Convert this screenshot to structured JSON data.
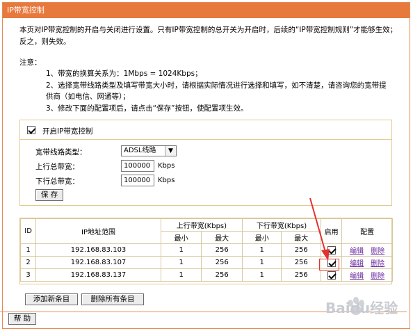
{
  "title": "IP带宽控制",
  "intro": "本页对IP带宽控制的开启与关闭进行设置。只有IP带宽控制的总开关为开启时，后续的“IP带宽控制规则”才能够生效；反之，则失效。",
  "notes": {
    "title": "注意：",
    "line1": "1、带宽的换算关系为：1Mbps = 1024Kbps；",
    "line2a": "2、选择宽带线路类型及填写带宽大小时，请根据实际情况进行选择和填写，如不清楚，请咨询您的宽带提",
    "line2b": "供商（如电信、网通等）；",
    "line3": "3、修改下面的配置项后，请点击“保存”按钮，使配置项生效。"
  },
  "control": {
    "enable_label": "开启IP带宽控制",
    "enabled": true,
    "line_type_label": "宽带线路类型：",
    "line_type_value": "ADSL线路",
    "up_label": "上行总带宽：",
    "up_value": "100000",
    "down_label": "下行总带宽：",
    "down_value": "100000",
    "unit": "Kbps",
    "save_label": "保 存"
  },
  "table": {
    "headers": {
      "id": "ID",
      "ip_range": "IP地址范围",
      "up": "上行带宽(Kbps)",
      "down": "下行带宽(Kbps)",
      "enable": "启用",
      "config": "配置",
      "min": "最小",
      "max": "最大"
    },
    "rows": [
      {
        "id": "1",
        "ip": "192.168.83.103",
        "up_min": "1",
        "up_max": "256",
        "down_min": "1",
        "down_max": "256",
        "enabled": true,
        "edit": "编辑",
        "delete": "删除"
      },
      {
        "id": "2",
        "ip": "192.168.83.107",
        "up_min": "1",
        "up_max": "256",
        "down_min": "1",
        "down_max": "256",
        "enabled": true,
        "edit": "编辑",
        "delete": "删除"
      },
      {
        "id": "3",
        "ip": "192.168.83.137",
        "up_min": "1",
        "up_max": "256",
        "down_min": "1",
        "down_max": "256",
        "enabled": true,
        "edit": "编辑",
        "delete": "删除"
      }
    ]
  },
  "buttons": {
    "add": "添加新条目",
    "delete_all": "删除所有条目",
    "help": "帮 助"
  },
  "colors": {
    "title_bar": "#e8793c",
    "annotation": "#e53030",
    "link": "#6a2ca0"
  },
  "watermark": "Baidu经验"
}
